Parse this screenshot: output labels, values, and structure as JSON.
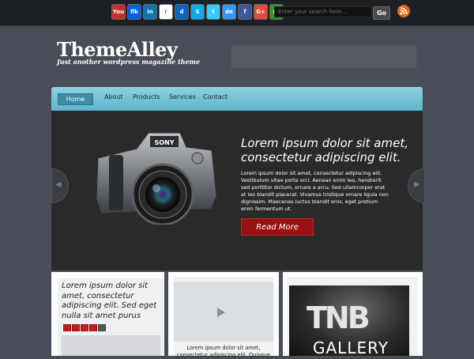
{
  "header": {
    "social_icons": [
      {
        "name": "youtube-icon",
        "glyph": "You",
        "color": "#c4302b"
      },
      {
        "name": "flickr-icon",
        "glyph": "flk",
        "color": "#0063dc"
      },
      {
        "name": "linkedin-icon",
        "glyph": "in",
        "color": "#0e76a8"
      },
      {
        "name": "reddit-icon",
        "glyph": "r",
        "color": "#ffffff"
      },
      {
        "name": "digg-icon",
        "glyph": "d",
        "color": "#0b64c0"
      },
      {
        "name": "skype-icon",
        "glyph": "S",
        "color": "#00aff0"
      },
      {
        "name": "twitter-icon",
        "glyph": "t",
        "color": "#33ccff"
      },
      {
        "name": "delicious-icon",
        "glyph": "de",
        "color": "#3399ff"
      },
      {
        "name": "facebook-icon",
        "glyph": "f",
        "color": "#3b5998"
      },
      {
        "name": "google-plus-icon",
        "glyph": "G+",
        "color": "#dd4b39"
      },
      {
        "name": "stumbleupon-icon",
        "glyph": "su",
        "color": "#2f9a2f"
      }
    ],
    "search_placeholder": "Enter your search here...",
    "search_button": "Go",
    "rss_icon": "rss-icon"
  },
  "brand": {
    "logo": "ThemeAlley",
    "tagline": "Just another wordpress magazine theme"
  },
  "nav": {
    "items": [
      "Home",
      "About",
      "Products",
      "Services",
      "Contact"
    ],
    "active": "Home"
  },
  "slider": {
    "title": "Lorem ipsum dolor sit amet, consectetur adipiscing elit.",
    "text": "Lorem ipsum dolor sit amet, consectetur adipiscing elit. Vestibulum vitae porta orci. Aenean enim leo, hendrerit sed porttitor dictum, ornare a arcu. Sed ullamcorper erat at leo blandit placerat. Vivamus tristique ornare ligula non dignissim. Maecenas luctus blandit eros, eget pretium enim fermentum ut.",
    "button": "Read More",
    "camera_brand": "SONY"
  },
  "columns": {
    "col1": {
      "title": "Lorem ipsum dolor sit amet, consectetur adipiscing elit. Sed eget nulla sit amet purus",
      "rating": 4,
      "rating_max": 5
    },
    "col2": {
      "caption": "Lorem ipsum dolor sit amet, consectetur adipiscing elit. Quisque"
    },
    "col3": {
      "logo": "TNB",
      "label": "GALLERY"
    }
  }
}
